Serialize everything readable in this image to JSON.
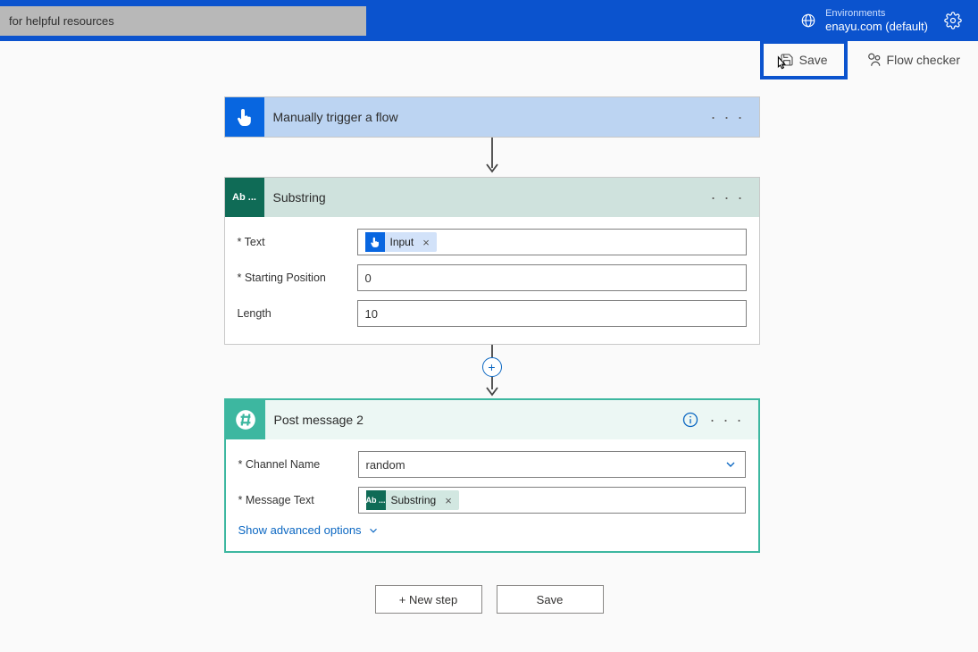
{
  "header": {
    "search_text": "for helpful resources",
    "env_label": "Environments",
    "env_name": "enayu.com (default)"
  },
  "toolbar": {
    "save_label": "Save",
    "flow_checker_label": "Flow checker"
  },
  "steps": {
    "trigger": {
      "title": "Manually trigger a flow"
    },
    "substring": {
      "title": "Substring",
      "text_label": "* Text",
      "text_token": "Input",
      "start_label": "* Starting Position",
      "start_value": "0",
      "length_label": "Length",
      "length_value": "10"
    },
    "postmsg": {
      "title": "Post message 2",
      "channel_label": "* Channel Name",
      "channel_value": "random",
      "msg_label": "* Message Text",
      "msg_token": "Substring",
      "advanced_link": "Show advanced options"
    }
  },
  "bottom": {
    "new_step": "+ New step",
    "save": "Save"
  },
  "icons": {
    "ab": "Ab ..."
  }
}
